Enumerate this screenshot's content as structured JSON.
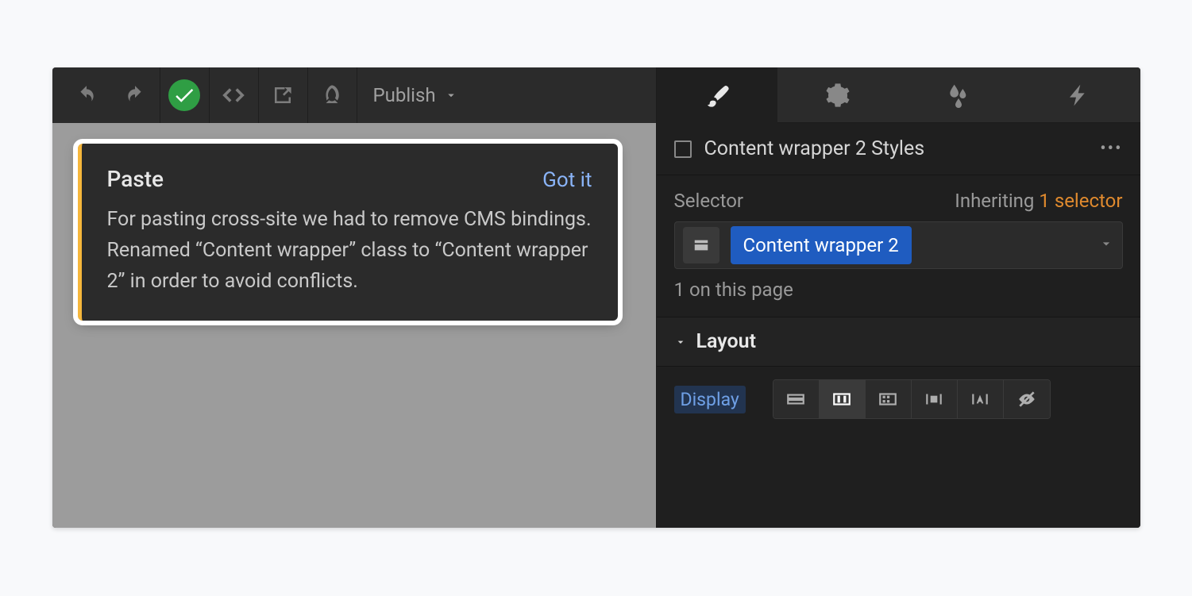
{
  "toolbar": {
    "publish_label": "Publish"
  },
  "toast": {
    "title": "Paste",
    "dismiss": "Got it",
    "line1": "For pasting cross-site we had to remove CMS bindings.",
    "line2": "Renamed “Content wrapper” class to “Content wrapper 2” in order to avoid conflicts."
  },
  "panel": {
    "styles_title": "Content wrapper 2 Styles",
    "selector_label": "Selector",
    "inheriting_label": "Inheriting ",
    "inheriting_count": "1 selector",
    "selected_class": "Content wrapper 2",
    "instance_count": "1 on this page",
    "layout_section": "Layout",
    "display_label": "Display"
  }
}
